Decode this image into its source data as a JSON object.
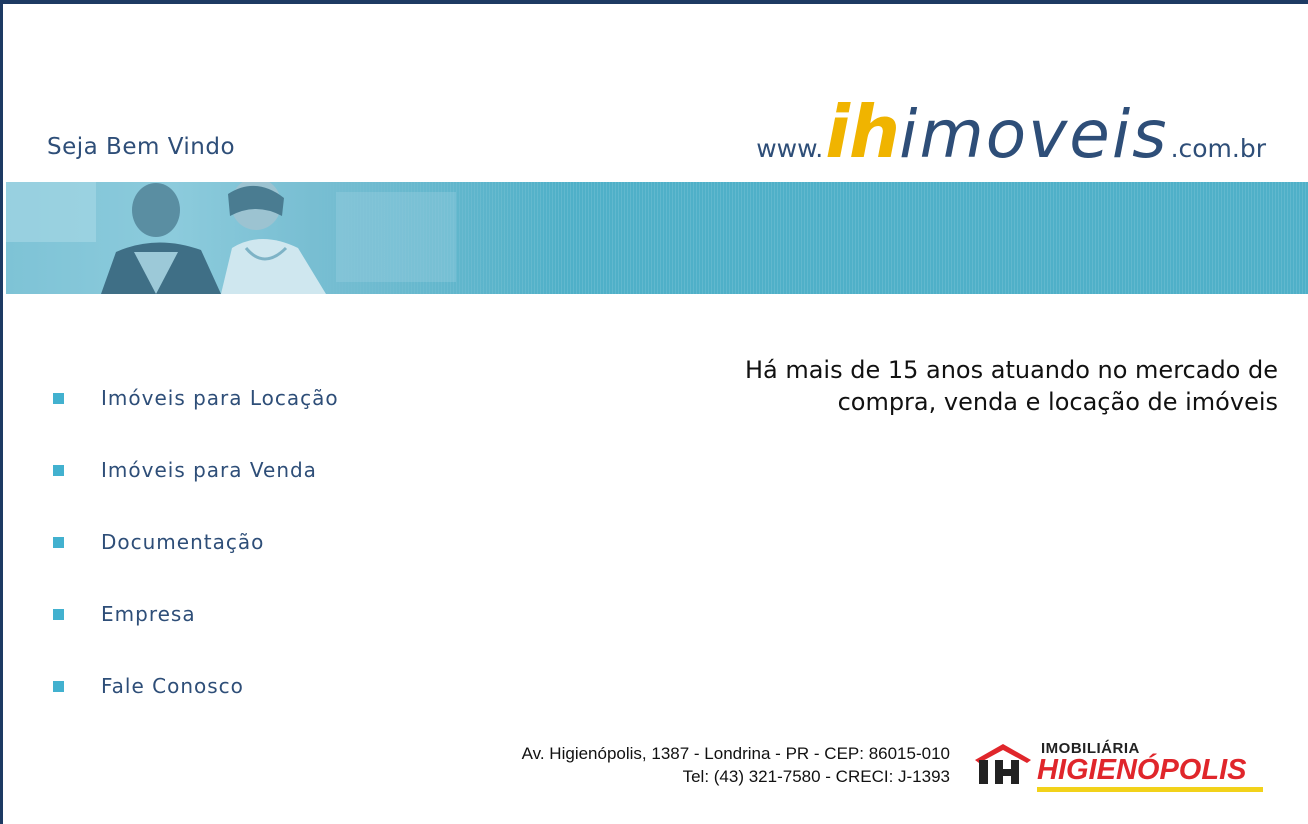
{
  "header": {
    "welcome": "Seja Bem Vindo",
    "site_url": {
      "prefix": "www.",
      "brand_highlight": "ih",
      "brand_rest": "imoveis",
      "suffix": ".com.br"
    }
  },
  "nav": {
    "items": [
      {
        "label": "Imóveis para Locação"
      },
      {
        "label": "Imóveis para Venda"
      },
      {
        "label": "Documentação"
      },
      {
        "label": "Empresa"
      },
      {
        "label": "Fale Conosco"
      }
    ]
  },
  "main": {
    "tagline_line1": "Há mais de 15 anos atuando no mercado de",
    "tagline_line2": "compra, venda e locação de imóveis"
  },
  "footer": {
    "address_line1": "Av. Higienópolis, 1387 - Londrina - PR - CEP: 86015-010",
    "address_line2": "Tel: (43) 321-7580 - CRECI: J-1393",
    "logo_top": "IMOBILIÁRIA",
    "logo_main": "HIGIENÓPOLIS"
  },
  "colors": {
    "navy": "#1d3a63",
    "text_blue": "#2e4e78",
    "banner_teal": "#4fb0c8",
    "bullet": "#42b1cf",
    "brand_gold": "#f0b400",
    "logo_red": "#e0262b",
    "logo_yellow": "#f2d21a"
  }
}
